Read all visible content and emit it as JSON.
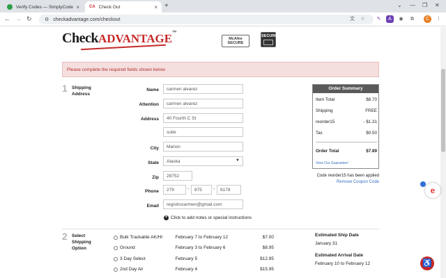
{
  "browser": {
    "tabs": [
      {
        "label": "Verify Codes — SimplyCodes",
        "active": false
      },
      {
        "label": "Check Out",
        "active": true
      }
    ],
    "url": "checkadvantage.com/checkout",
    "new_tab": "+",
    "window_controls": [
      "⌄",
      "—",
      "❐",
      "✕"
    ]
  },
  "header": {
    "logo_check": "Check",
    "logo_advantage": "ADVANTAGE",
    "logo_tm": "™",
    "mcafee_badge": [
      "McAfee",
      "SECURE"
    ],
    "secure_badge": "SECURE"
  },
  "alert": {
    "text": "Please complete the required fields shown below"
  },
  "shipping_address": {
    "step_number": "1",
    "title": [
      "Shipping",
      "Address"
    ],
    "fields": {
      "name": {
        "label": "Name",
        "value": "carmen alvarez"
      },
      "attention": {
        "label": "Attention",
        "value": "carmen alvarez"
      },
      "address1": {
        "label": "Address",
        "value": "40 Fourth C St"
      },
      "address2": {
        "value": "suite"
      },
      "city": {
        "label": "City",
        "value": "Marion"
      },
      "state": {
        "label": "State",
        "value": "Alaska"
      },
      "zip": {
        "label": "Zip",
        "value": "28752"
      },
      "phone": {
        "label": "Phone",
        "area": "279",
        "prefix": "875",
        "line": "6178"
      },
      "email": {
        "label": "Email",
        "value": "registrocarmen@gmail.com"
      }
    },
    "add_notes": "Click to add notes or special instructions"
  },
  "order_summary": {
    "title": "Order Summary",
    "rows": [
      {
        "label": "Item Total",
        "value": "$8.70"
      },
      {
        "label": "Shipping",
        "value": "FREE"
      },
      {
        "label": "reorder15",
        "value": "- $1.31"
      },
      {
        "label": "Tax",
        "value": "$0.50"
      }
    ],
    "total": {
      "label": "Order Total",
      "value": "$7.89"
    },
    "guarantee_link": "View Our Guarantee!",
    "coupon_message": "Code reorder15 has been applied",
    "remove_coupon": "Remove Coupon Code"
  },
  "shipping_option": {
    "step_number": "2",
    "title": [
      "Select",
      "Shipping",
      "Option"
    ],
    "options": [
      {
        "service": "Bulk Trackable AK/HI",
        "dates": "February 7 to February 12",
        "price": "$7.00"
      },
      {
        "service": "Ground",
        "dates": "February 3 to February 6",
        "price": "$8.95"
      },
      {
        "service": "3 Day Select",
        "dates": "February 5",
        "price": "$12.95"
      },
      {
        "service": "2nd Day Air",
        "dates": "February 4",
        "price": "$15.95"
      }
    ],
    "est_ship_label": "Estimated Ship Date",
    "est_ship_value": "January 31",
    "est_arrival_label": "Estimated Arrival Date",
    "est_arrival_value": "February 10 to February 12"
  },
  "colors": {
    "accent": "#c62828",
    "link": "#3a6fc0",
    "alert_bg": "#f5dede"
  }
}
